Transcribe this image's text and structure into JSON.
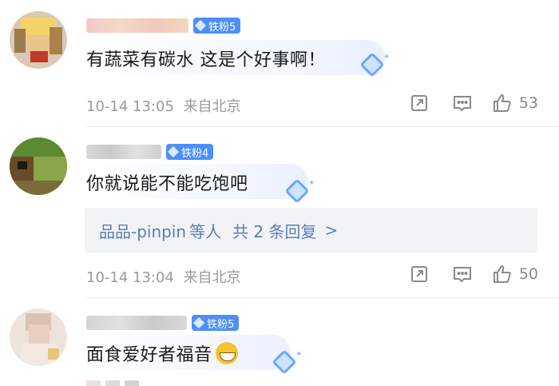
{
  "colors": {
    "accent": "#4d8ff7",
    "meta": "#9a9a9a",
    "reply_link": "#5b7db7",
    "reply_bg": "#f2f3f5"
  },
  "comments": [
    {
      "badge": "铁粉5",
      "text": "有蔬菜有碳水 这是个好事啊！",
      "time": "10-14 13:05",
      "location": "来自北京",
      "likes": "53"
    },
    {
      "badge": "铁粉4",
      "text": "你就说能不能吃饱吧",
      "time": "10-14 13:04",
      "location": "来自北京",
      "likes": "50",
      "reply_summary": {
        "name": "品品-pinpin",
        "suffix": "等人",
        "count": "共 2 条回复",
        "arrow": ">"
      }
    },
    {
      "badge": "铁粉5",
      "text": "面食爱好者福音",
      "emoji": "grinning-face"
    }
  ],
  "icons": [
    "fan-gem-icon",
    "share-icon",
    "comment-icon",
    "like-icon",
    "sparkle-gem-icon"
  ]
}
